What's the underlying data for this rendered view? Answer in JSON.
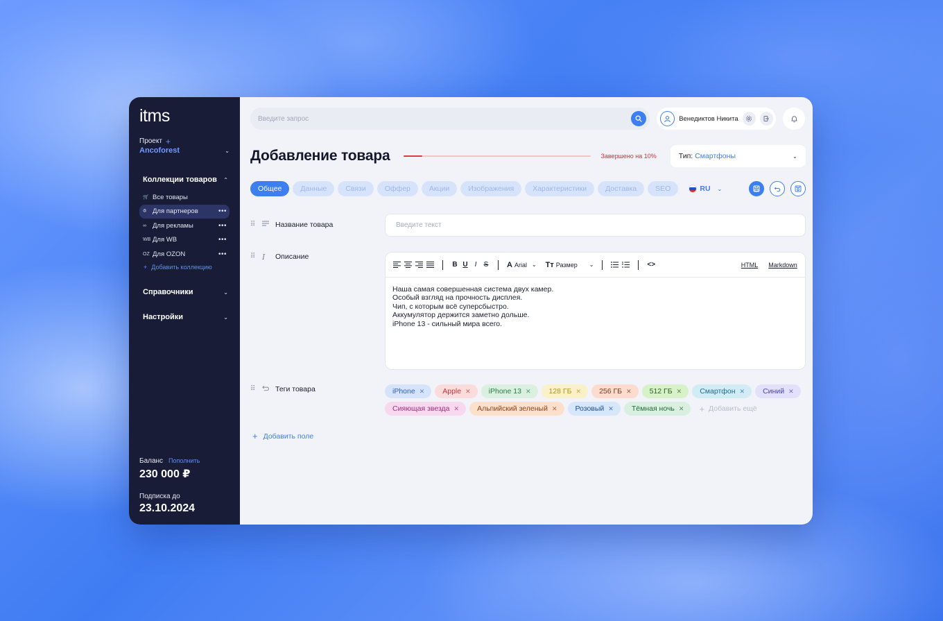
{
  "sidebar": {
    "logo": "itms",
    "project_label": "Проект",
    "project_plus": "+",
    "project_name": "Ancoforest",
    "collections_title": "Коллекции товаров",
    "items": [
      {
        "label": "Все товары",
        "icon": "cart-icon",
        "glyph": "🛒",
        "more": false
      },
      {
        "label": "Для партнеров",
        "icon": "users-icon",
        "glyph": "ꔮ",
        "more": true,
        "active": true
      },
      {
        "label": "Для рекламы",
        "icon": "link-icon",
        "glyph": "∞",
        "more": true
      },
      {
        "label": "Для WB",
        "icon": "wb-icon",
        "glyph": "WB",
        "more": true
      },
      {
        "label": "Для OZON",
        "icon": "oz-icon",
        "glyph": "OZ",
        "more": true
      }
    ],
    "more_glyph": "•••",
    "add_collection": "Добавить коллекцию",
    "references_title": "Справочники",
    "settings_title": "Настройки",
    "balance_label": "Баланс",
    "topup_label": "Пополнить",
    "balance_value": "230 000 ₽",
    "subscription_label": "Подписка до",
    "subscription_value": "23.10.2024"
  },
  "topbar": {
    "search_placeholder": "Введите запрос",
    "user_name": "Венедиктов Никита"
  },
  "header": {
    "title": "Добавление товара",
    "progress_percent": 10,
    "progress_text": "Завершено на 10%",
    "type_label": "Тип:",
    "type_value": "Смартфоны"
  },
  "tabs": [
    {
      "label": "Общее",
      "active": true
    },
    {
      "label": "Данные"
    },
    {
      "label": "Связи"
    },
    {
      "label": "Оффер"
    },
    {
      "label": "Акции"
    },
    {
      "label": "Изображения"
    },
    {
      "label": "Характеристики"
    },
    {
      "label": "Доставка"
    },
    {
      "label": "SEO"
    }
  ],
  "language": "RU",
  "fields": {
    "name_label": "Название товара",
    "name_placeholder": "Введите текст",
    "description_label": "Описание",
    "tags_label": "Теги товара",
    "add_field": "Добавить поле"
  },
  "editor": {
    "font_name": "Arial",
    "size_label": "Размер",
    "mode_html": "HTML",
    "mode_markdown": "Markdown",
    "lines": [
      "Наша самая совершенная система двух камер.",
      "Особый взгляд на прочность дисплея.",
      "Чип, с которым всё суперсбыстро.",
      "Аккумулятор держится заметно дольше.",
      "iPhone 13 - сильный мира всего."
    ]
  },
  "tags": [
    {
      "label": "iPhone",
      "bg": "#d6e4fb",
      "fg": "#2f5fb8"
    },
    {
      "label": "Apple",
      "bg": "#fbdcdc",
      "fg": "#b43a3a"
    },
    {
      "label": "iPhone 13",
      "bg": "#d9f0e0",
      "fg": "#2c7a45"
    },
    {
      "label": "128 ГБ",
      "bg": "#fbf1c8",
      "fg": "#b09420"
    },
    {
      "label": "256 ГБ",
      "bg": "#fbdcce",
      "fg": "#7a3b1f"
    },
    {
      "label": "512 ГБ",
      "bg": "#d7f2c8",
      "fg": "#2f5e1e"
    },
    {
      "label": "Смартфон",
      "bg": "#d2ecf6",
      "fg": "#1e6a8a"
    },
    {
      "label": "Синий",
      "bg": "#e2e0fb",
      "fg": "#4a45b0"
    },
    {
      "label": "Сияющая звезда",
      "bg": "#f8d8ee",
      "fg": "#a02c7a"
    },
    {
      "label": "Альпийский зеленый",
      "bg": "#fde0cb",
      "fg": "#8a4414"
    },
    {
      "label": "Розовый",
      "bg": "#d6e6fb",
      "fg": "#1f4e9a"
    },
    {
      "label": "Тёмная ночь",
      "bg": "#d9f0e0",
      "fg": "#216a3a"
    }
  ],
  "tags_add": "Добавить ещё",
  "colors": {
    "accent": "#3d7ef0",
    "sidebar_bg": "#191c36",
    "progress": "#d83a46"
  }
}
